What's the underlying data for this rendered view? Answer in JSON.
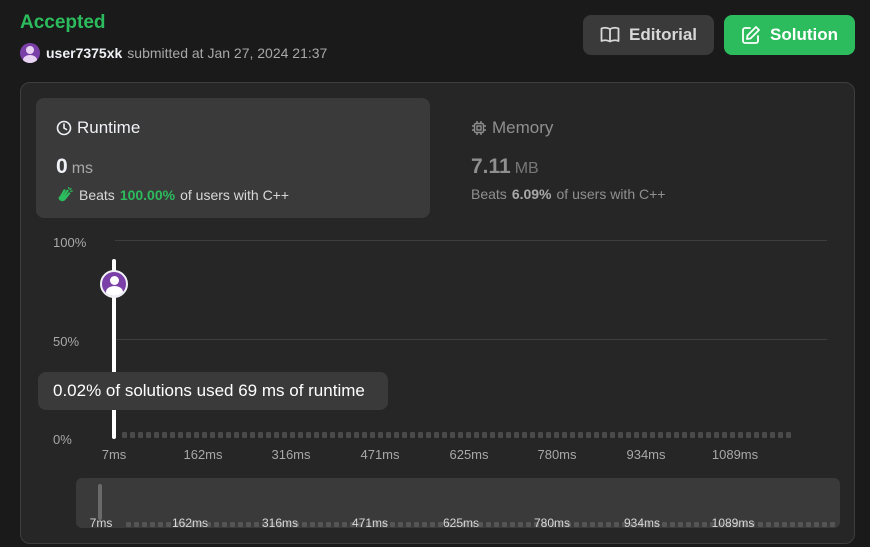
{
  "header": {
    "status": "Accepted",
    "username": "user7375xk",
    "submitted_text": "submitted at Jan 27, 2024 21:37"
  },
  "actions": {
    "editorial_label": "Editorial",
    "solution_label": "Solution"
  },
  "runtime": {
    "title": "Runtime",
    "value": "0",
    "unit": "ms",
    "beats_label": "Beats",
    "beats_pct": "100.00%",
    "beats_suffix": "of users with C++"
  },
  "memory": {
    "title": "Memory",
    "value": "7.11",
    "unit": "MB",
    "beats_label": "Beats",
    "beats_pct": "6.09%",
    "beats_suffix": "of users with C++"
  },
  "chart": {
    "y_ticks": [
      "100%",
      "50%",
      "0%"
    ],
    "x_ticks": [
      "7ms",
      "162ms",
      "316ms",
      "471ms",
      "625ms",
      "780ms",
      "934ms",
      "1089ms"
    ],
    "tooltip": "0.02% of solutions used 69 ms of runtime",
    "scrubber_ticks": [
      "7ms",
      "162ms",
      "316ms",
      "471ms",
      "625ms",
      "780ms",
      "934ms",
      "1089ms"
    ]
  },
  "colors": {
    "accent_green": "#2cbb5d",
    "avatar_purple": "#7b3fa8"
  }
}
